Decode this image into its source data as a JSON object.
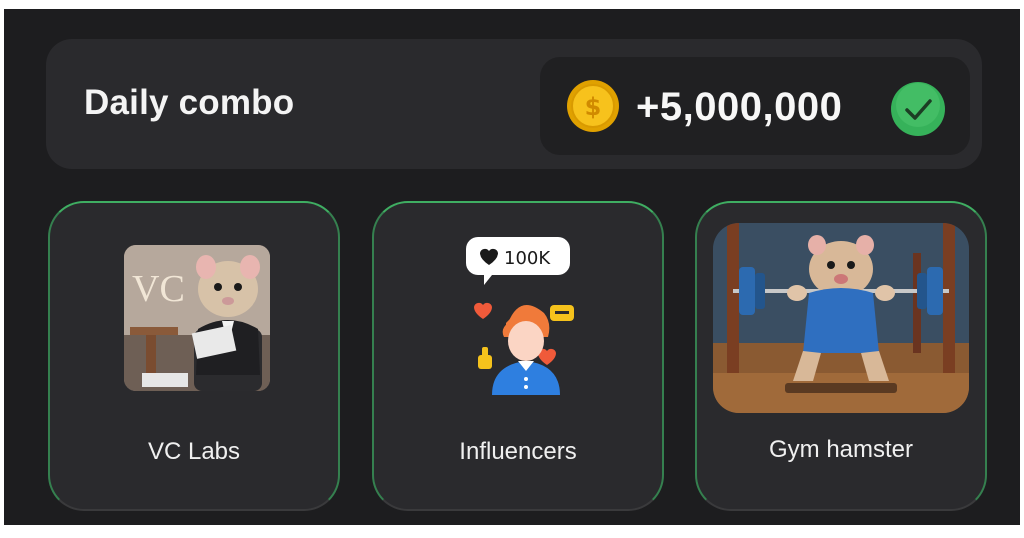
{
  "header": {
    "title": "Daily combo",
    "reward_amount": "+5,000,000",
    "coin_icon": "coin-icon",
    "status_icon": "checkmark-icon"
  },
  "cards": [
    {
      "label": "VC Labs",
      "image": "hamster-vc-labs-image",
      "art_text": "VC"
    },
    {
      "label": "Influencers",
      "image": "influencer-icon",
      "likes_badge": "100K"
    },
    {
      "label": "Gym hamster",
      "image": "gym-hamster-image"
    }
  ],
  "colors": {
    "background": "#1d1d1f",
    "panel": "#2a2a2d",
    "accent_green": "#3fae62",
    "coin_gold": "#f2b400"
  }
}
